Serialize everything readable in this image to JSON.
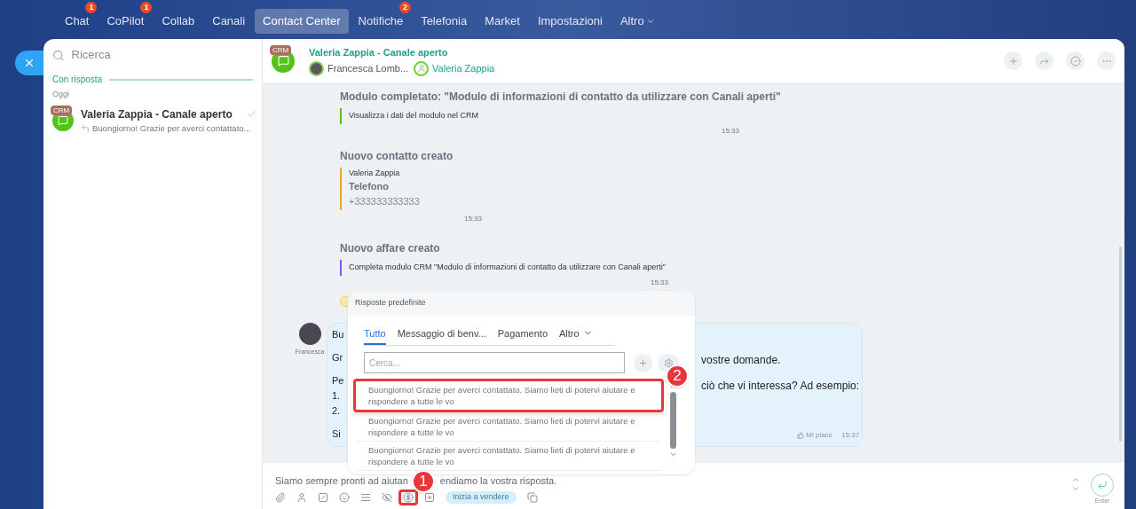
{
  "top_nav": [
    {
      "label": "Chat",
      "selected": false,
      "badge": "1"
    },
    {
      "label": "CoPilot",
      "selected": false,
      "badge": "1"
    },
    {
      "label": "Collab",
      "selected": false
    },
    {
      "label": "Canali",
      "selected": false
    },
    {
      "label": "Contact Center",
      "selected": true
    },
    {
      "label": "Notifiche",
      "selected": false,
      "badge": "2"
    },
    {
      "label": "Telefonia",
      "selected": false
    },
    {
      "label": "Market",
      "selected": false
    },
    {
      "label": "Impostazioni",
      "selected": false
    },
    {
      "label": "Altro",
      "selected": false,
      "dropdown": true
    }
  ],
  "sidebar": {
    "search_placeholder": "Ricerca",
    "group": "Con risposta",
    "date": "Oggi",
    "chats": [
      {
        "title": "Valeria Zappia - Canale aperto",
        "preview": "Buongiorno! Grazie per averci contattato...",
        "badge": "CRM",
        "selected": false
      }
    ]
  },
  "chat_header": {
    "badge": "CRM",
    "title": "Valeria Zappia - Canale aperto",
    "participants": [
      {
        "name": "Francesca Lomb...",
        "kind": "operator"
      },
      {
        "name": "Valeria Zappia",
        "kind": "client"
      }
    ]
  },
  "messages": [
    {
      "kind": "link",
      "title": "Modulo completato: \"Modulo di informazioni di contatto da utilizzare con Canali aperti\"",
      "color": "#55c21a",
      "text": "Visualizza i dati del modulo nel CRM",
      "time": "15:33"
    },
    {
      "kind": "contact",
      "title": "Nuovo contatto creato",
      "color": "#f2a432",
      "name": "Valeria Zappia",
      "field_label": "Telefono",
      "field_value": "+333333333333",
      "time": "15:33"
    },
    {
      "kind": "link",
      "title": "Nuovo affare creato",
      "color": "#8c4dfa",
      "text": "Completa modulo CRM \"Modulo di informazioni di contatto da utilizzare con Canali aperti\"",
      "time": "15:33"
    }
  ],
  "bubble": {
    "author": "Francesca",
    "left_fragments": [
      "Bu",
      "Gr",
      "Pe",
      "1.",
      "2.",
      "Si"
    ],
    "right_fragments": [
      "vostre domande.",
      "ciò che vi interessa? Ad esempio:"
    ],
    "like": "Mi piace",
    "time": "15:37"
  },
  "popup": {
    "title": "Risposte predefinite",
    "tabs": [
      {
        "label": "Tutto",
        "selected": true
      },
      {
        "label": "Messaggio di benv...",
        "selected": false
      },
      {
        "label": "Pagamento",
        "selected": false
      },
      {
        "label": "Altro",
        "selected": false,
        "dropdown": true
      }
    ],
    "search_placeholder": "Cerca...",
    "items": [
      {
        "text": "Buongiorno! Grazie per averci contattato. Siamo lieti di potervi aiutare e rispondere a tutte le vo",
        "annotation": "2"
      },
      {
        "text": "Buongiorno! Grazie per averci contattato. Siamo lieti di potervi aiutare e rispondere a tutte le vo"
      },
      {
        "text": "Buongiorno! Grazie per averci contattato. Siamo lieti di potervi aiutare e rispondere a tutte le vo"
      }
    ]
  },
  "composer": {
    "placeholder_parts": [
      "Siamo sempre pronti ad aiutan",
      "endiamo la vostra risposta."
    ],
    "tools": [
      {
        "kind": "paperclip"
      },
      {
        "kind": "user"
      },
      {
        "kind": "slash"
      },
      {
        "kind": "smile"
      },
      {
        "kind": "list"
      },
      {
        "kind": "hide"
      },
      {
        "kind": "dollar",
        "annotation": "1"
      },
      {
        "kind": "add"
      },
      {
        "kind": "sell",
        "label": "Inizia a vendere"
      },
      {
        "kind": "copy"
      }
    ],
    "enter_label": "Enter"
  }
}
